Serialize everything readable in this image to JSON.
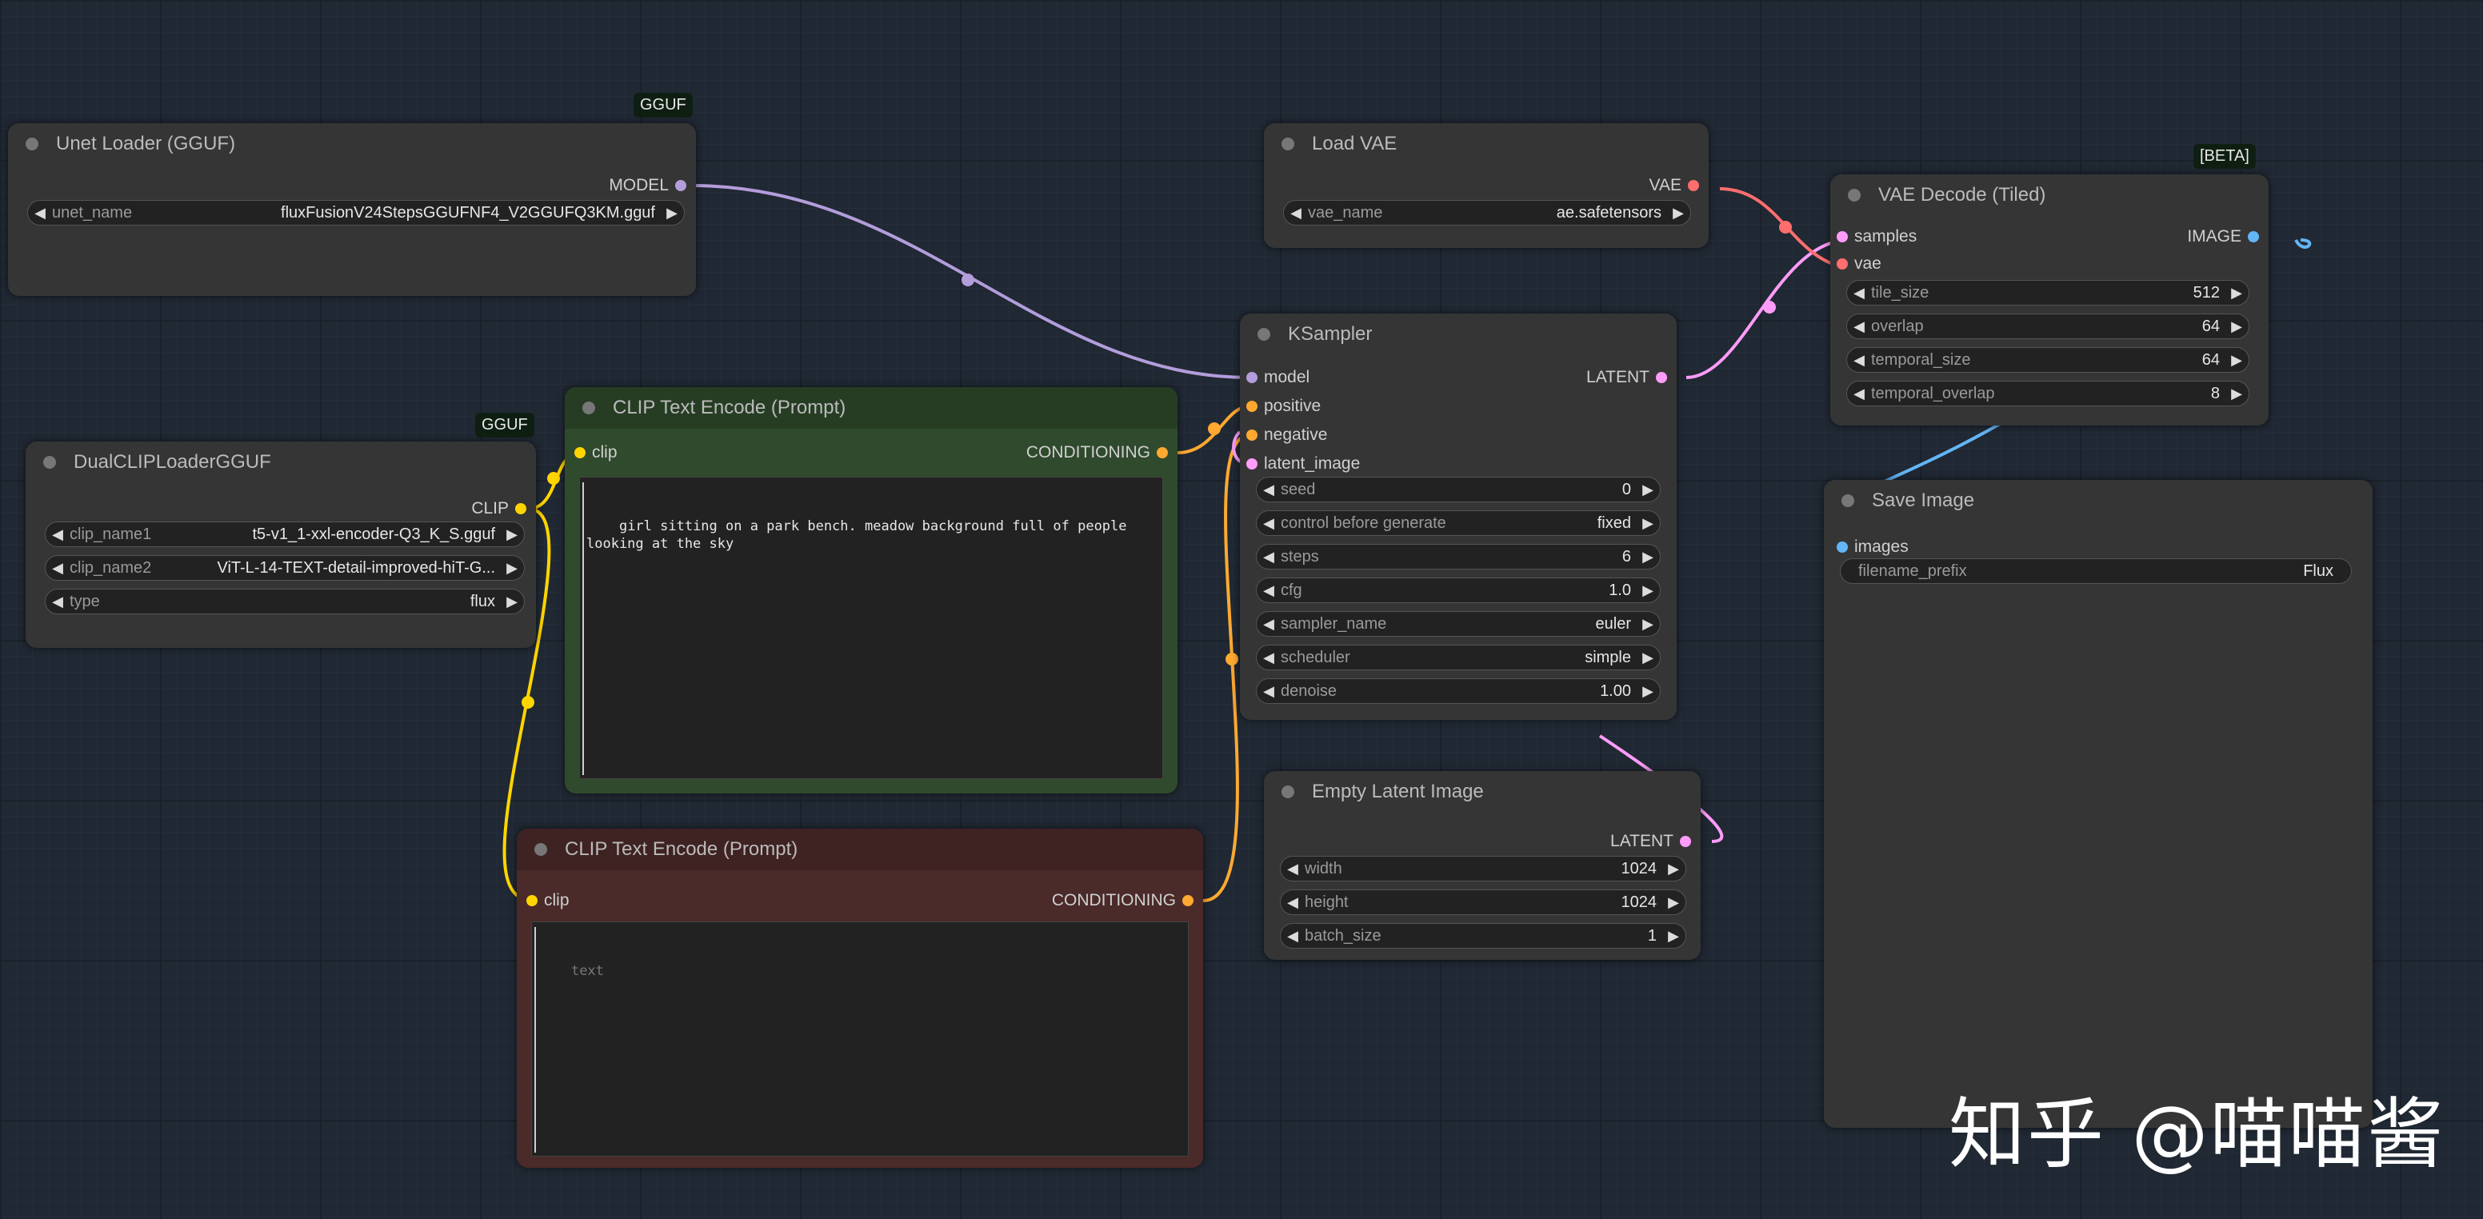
{
  "colors": {
    "model_wire": "#b39ddb",
    "clip_wire": "#ffd500",
    "conditioning_wire": "#ffa931",
    "latent_wire": "#ff9cf9",
    "vae_wire": "#ff6e6e",
    "image_wire": "#64b5f6",
    "green_node": "#2f4a2c",
    "red_node": "#4b2a2a",
    "canvas": "#202833"
  },
  "ui": {
    "unet_loader": {
      "badge": "GGUF",
      "title": "Unet Loader (GGUF)",
      "output": "MODEL",
      "widget": {
        "label": "unet_name",
        "value": "fluxFusionV24StepsGGUFNF4_V2GGUFQ3KM.gguf"
      }
    },
    "dualclip": {
      "badge": "GGUF",
      "title": "DualCLIPLoaderGGUF",
      "output": "CLIP",
      "widgets": [
        {
          "label": "clip_name1",
          "value": "t5-v1_1-xxl-encoder-Q3_K_S.gguf"
        },
        {
          "label": "clip_name2",
          "value": "ViT-L-14-TEXT-detail-improved-hiT-G..."
        },
        {
          "label": "type",
          "value": "flux"
        }
      ]
    },
    "clip_pos": {
      "title": "CLIP Text Encode (Prompt)",
      "input": "clip",
      "output": "CONDITIONING",
      "text": "girl sitting on a park bench. meadow background full of people\nlooking at the sky"
    },
    "clip_neg": {
      "title": "CLIP Text Encode (Prompt)",
      "input": "clip",
      "output": "CONDITIONING",
      "placeholder": "text"
    },
    "load_vae": {
      "title": "Load VAE",
      "output": "VAE",
      "widget": {
        "label": "vae_name",
        "value": "ae.safetensors"
      }
    },
    "ksampler": {
      "title": "KSampler",
      "inputs": [
        "model",
        "positive",
        "negative",
        "latent_image"
      ],
      "output": "LATENT",
      "widgets": [
        {
          "label": "seed",
          "value": "0"
        },
        {
          "label": "control before generate",
          "value": "fixed"
        },
        {
          "label": "steps",
          "value": "6"
        },
        {
          "label": "cfg",
          "value": "1.0"
        },
        {
          "label": "sampler_name",
          "value": "euler"
        },
        {
          "label": "scheduler",
          "value": "simple"
        },
        {
          "label": "denoise",
          "value": "1.00"
        }
      ]
    },
    "empty_latent": {
      "title": "Empty Latent Image",
      "output": "LATENT",
      "widgets": [
        {
          "label": "width",
          "value": "1024"
        },
        {
          "label": "height",
          "value": "1024"
        },
        {
          "label": "batch_size",
          "value": "1"
        }
      ]
    },
    "vae_decode": {
      "badge": "[BETA]",
      "title": "VAE Decode (Tiled)",
      "inputs": [
        "samples",
        "vae"
      ],
      "output": "IMAGE",
      "widgets": [
        {
          "label": "tile_size",
          "value": "512"
        },
        {
          "label": "overlap",
          "value": "64"
        },
        {
          "label": "temporal_size",
          "value": "64"
        },
        {
          "label": "temporal_overlap",
          "value": "8"
        }
      ]
    },
    "save_image": {
      "title": "Save Image",
      "input": "images",
      "widget": {
        "label": "filename_prefix",
        "value": "Flux"
      }
    },
    "watermark": "知乎 @喵喵酱"
  }
}
